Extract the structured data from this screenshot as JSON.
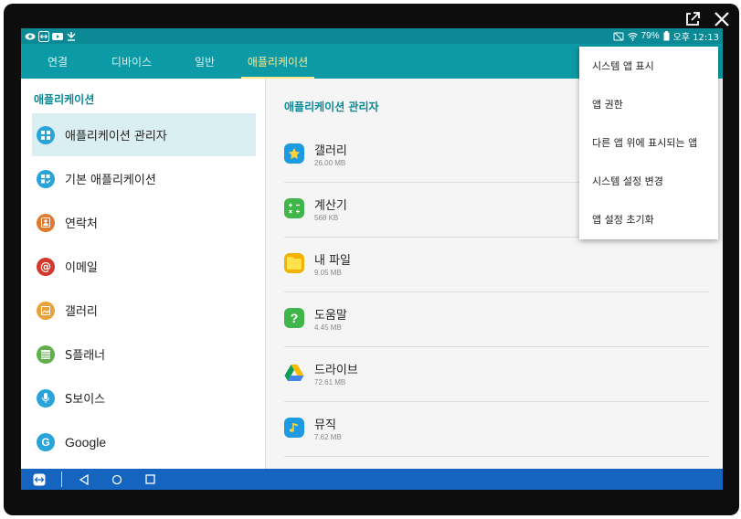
{
  "frame": {
    "icons": [
      "external-link-icon",
      "close-icon"
    ]
  },
  "status_bar": {
    "battery": "79%",
    "time": "오후 12:13",
    "left_icons": [
      "eye-icon",
      "teamviewer-icon",
      "youtube-icon",
      "download-icon"
    ]
  },
  "tabs": [
    {
      "label": "연결",
      "active": false
    },
    {
      "label": "디바이스",
      "active": false
    },
    {
      "label": "일반",
      "active": false
    },
    {
      "label": "애플리케이션",
      "active": true
    }
  ],
  "left_panel": {
    "title": "애플리케이션",
    "items": [
      {
        "label": "애플리케이션 관리자",
        "icon": "apps-grid-icon",
        "color": "#2aa3d9",
        "selected": true
      },
      {
        "label": "기본 애플리케이션",
        "icon": "default-apps-icon",
        "color": "#2aa3d9",
        "selected": false
      },
      {
        "label": "연락처",
        "icon": "contact-icon",
        "color": "#e07a2e",
        "selected": false
      },
      {
        "label": "이메일",
        "icon": "email-icon",
        "color": "#d2382b",
        "selected": false
      },
      {
        "label": "갤러리",
        "icon": "gallery-icon",
        "color": "#e8a23a",
        "selected": false
      },
      {
        "label": "S플래너",
        "icon": "calendar-icon",
        "color": "#5fb04a",
        "selected": false
      },
      {
        "label": "S보이스",
        "icon": "microphone-icon",
        "color": "#2aa3d9",
        "selected": false
      },
      {
        "label": "Google",
        "icon": "google-icon",
        "color": "#2aa3d9",
        "selected": false
      }
    ]
  },
  "right_panel": {
    "title": "애플리케이션 관리자",
    "apps": [
      {
        "name": "갤러리",
        "size": "26.00 MB",
        "icon": "gallery-app-icon"
      },
      {
        "name": "계산기",
        "size": "568 KB",
        "icon": "calculator-app-icon"
      },
      {
        "name": "내 파일",
        "size": "9.05 MB",
        "icon": "my-files-app-icon"
      },
      {
        "name": "도움말",
        "size": "4.45 MB",
        "icon": "help-app-icon"
      },
      {
        "name": "드라이브",
        "size": "72.61 MB",
        "icon": "drive-app-icon"
      },
      {
        "name": "뮤직",
        "size": "7.62 MB",
        "icon": "music-app-icon"
      }
    ]
  },
  "overflow_menu": {
    "items": [
      {
        "label": "시스템 앱 표시"
      },
      {
        "label": "앱 권한"
      },
      {
        "label": "다른 앱 위에 표시되는 앱"
      },
      {
        "label": "시스템 설정 변경"
      },
      {
        "label": "앱 설정 초기화"
      }
    ]
  },
  "nav_bar": {
    "icons": [
      "teamviewer-icon",
      "back-icon",
      "home-icon",
      "recents-icon"
    ]
  },
  "colors": {
    "status_bar": "#0b8a96",
    "tab_bar": "#0b9aa6",
    "accent": "#0b8a96",
    "active_tab": "#ffe98a",
    "nav_bar": "#1565c0"
  }
}
